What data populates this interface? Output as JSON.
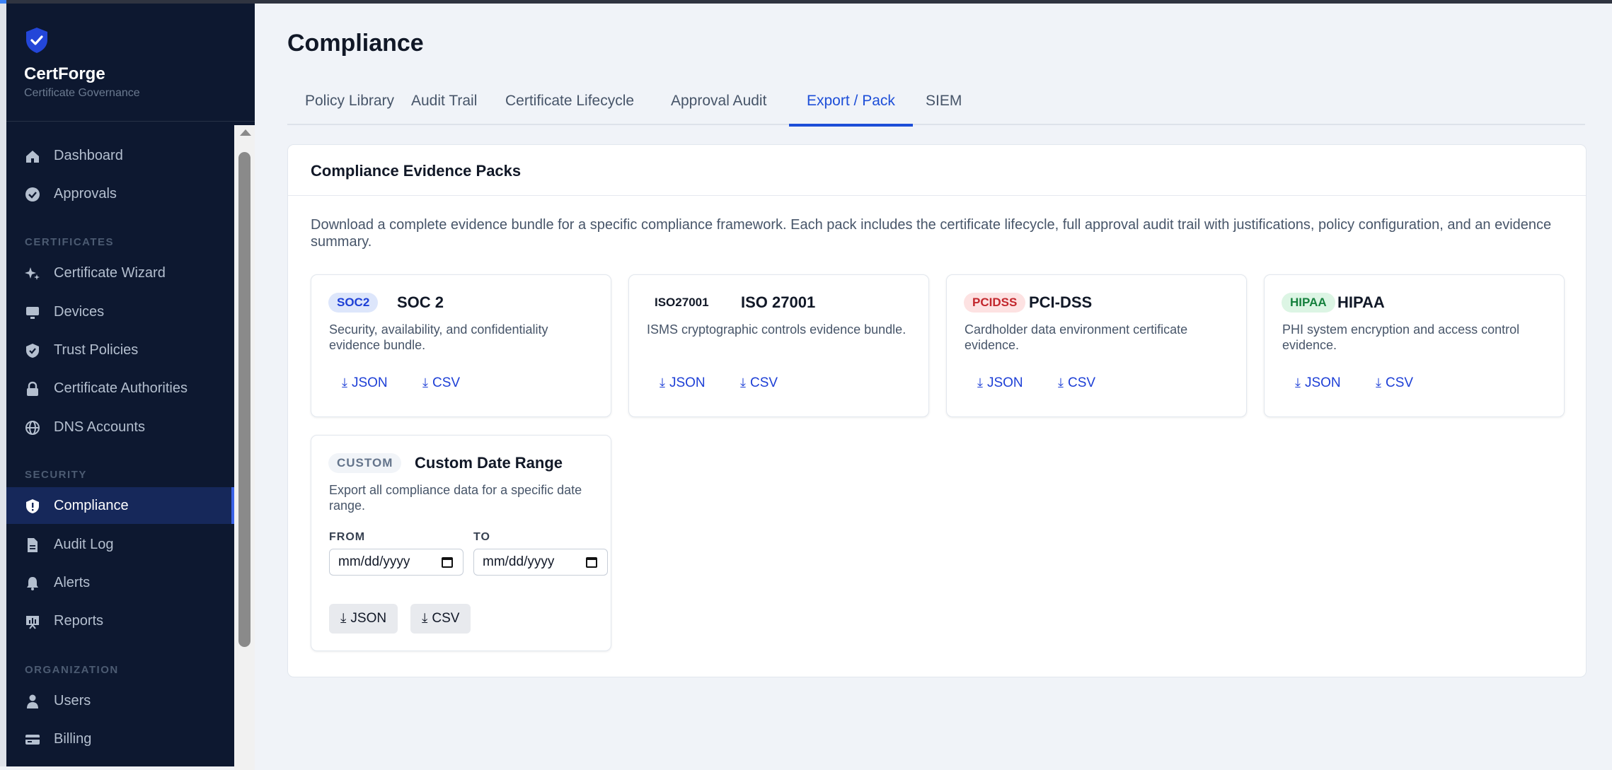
{
  "app": {
    "name": "CertForge",
    "subtitle": "Certificate Governance"
  },
  "sidebar": {
    "items": [
      {
        "label": "Dashboard",
        "icon": "home-icon"
      },
      {
        "label": "Approvals",
        "icon": "check-circle-icon"
      },
      {
        "label": "Certificate Wizard",
        "icon": "sparkles-icon"
      },
      {
        "label": "Devices",
        "icon": "monitor-icon"
      },
      {
        "label": "Trust Policies",
        "icon": "shield-check-icon"
      },
      {
        "label": "Certificate Authorities",
        "icon": "lock-icon"
      },
      {
        "label": "DNS Accounts",
        "icon": "globe-icon"
      },
      {
        "label": "Compliance",
        "icon": "shield-alert-icon",
        "active": true
      },
      {
        "label": "Audit Log",
        "icon": "document-icon"
      },
      {
        "label": "Alerts",
        "icon": "bell-icon"
      },
      {
        "label": "Reports",
        "icon": "chart-icon"
      },
      {
        "label": "Users",
        "icon": "user-icon"
      },
      {
        "label": "Billing",
        "icon": "credit-card-icon"
      }
    ],
    "sections": {
      "certificates": "CERTIFICATES",
      "security": "SECURITY",
      "organization": "ORGANIZATION"
    }
  },
  "page": {
    "title": "Compliance",
    "tabs": [
      "Policy Library",
      "Audit Trail",
      "Certificate Lifecycle",
      "Approval Audit",
      "Export / Pack",
      "SIEM"
    ],
    "active_tab": "Export / Pack"
  },
  "evidence": {
    "title": "Compliance Evidence Packs",
    "description": "Download a complete evidence bundle for a specific compliance framework. Each pack includes the certificate lifecycle, full approval audit trail with justifications, policy configuration, and an evidence summary.",
    "packs": [
      {
        "badge": "SOC2",
        "name": "SOC 2",
        "description": "Security, availability, and confidentiality evidence bundle.",
        "json": "JSON",
        "csv": "CSV",
        "badge_color": "#1d3fd6",
        "badge_bg": "#dde6fb"
      },
      {
        "badge": "ISO27001",
        "name": "ISO 27001",
        "description": "ISMS cryptographic controls evidence bundle.",
        "json": "JSON",
        "csv": "CSV",
        "badge_color": "#111827",
        "badge_bg": "#ffffff"
      },
      {
        "badge": "PCIDSS",
        "name": "PCI-DSS",
        "description": "Cardholder data environment certificate evidence.",
        "json": "JSON",
        "csv": "CSV",
        "badge_color": "#c2272d",
        "badge_bg": "#fde2e2"
      },
      {
        "badge": "HIPAA",
        "name": "HIPAA",
        "description": "PHI system encryption and access control evidence.",
        "json": "JSON",
        "csv": "CSV",
        "badge_color": "#15803d",
        "badge_bg": "#dcf5e4"
      }
    ],
    "custom": {
      "badge": "CUSTOM",
      "name": "Custom Date Range",
      "description": "Export all compliance data for a specific date range.",
      "from_label": "FROM",
      "to_label": "TO",
      "from_value": "mm/dd/yyyy",
      "to_value": "mm/dd/yyyy",
      "json": "JSON",
      "csv": "CSV"
    },
    "download_glyph": "⤓"
  },
  "colors": {
    "accent": "#1d4ed8",
    "sidebar_bg": "#0d1830",
    "active_nav_bg": "#16285a"
  }
}
